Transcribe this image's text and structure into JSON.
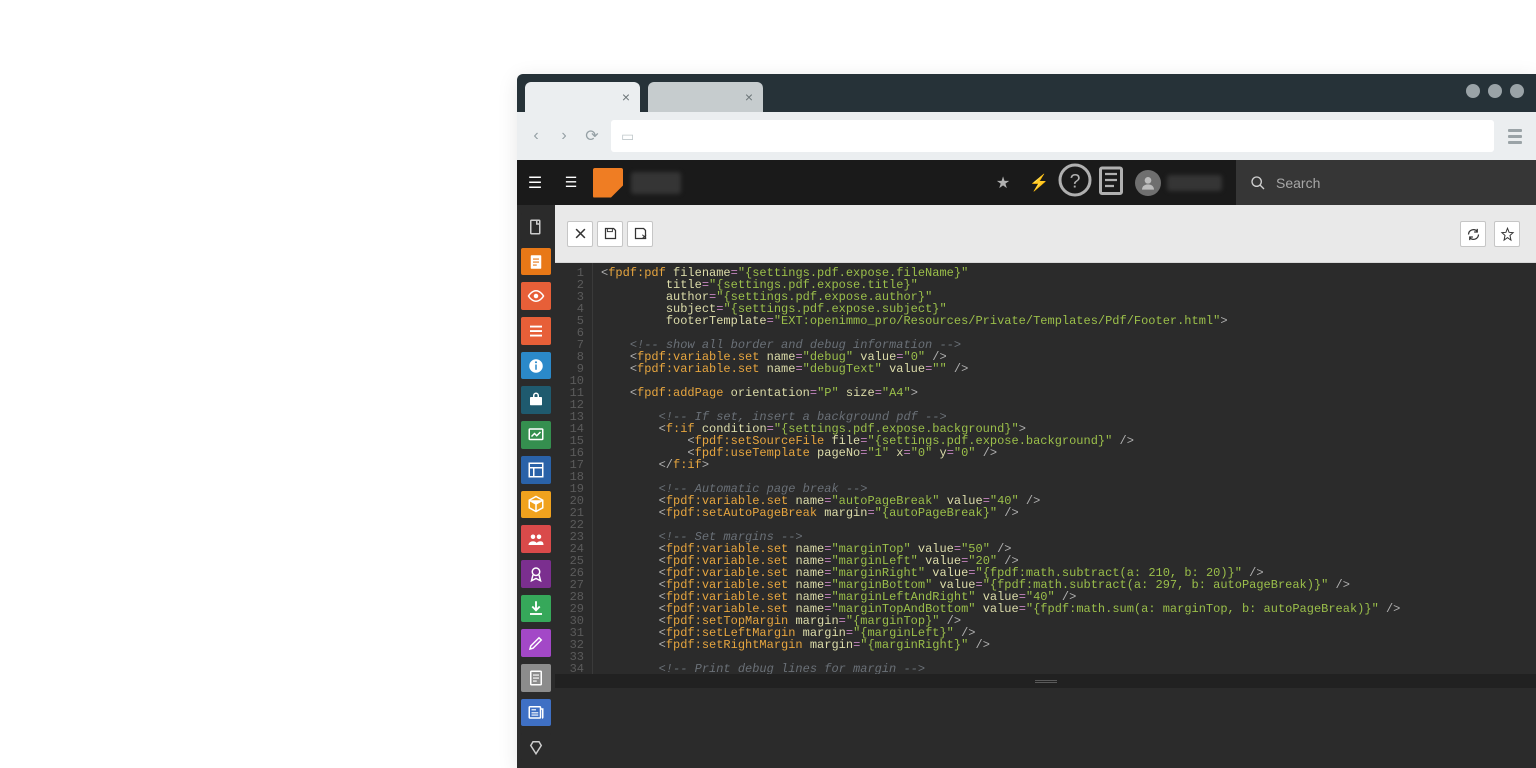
{
  "browser": {
    "tabs": [
      {
        "close_label": "×"
      },
      {
        "close_label": "×"
      }
    ]
  },
  "topbar": {
    "search_placeholder": "Search"
  },
  "sidebar": {
    "items": [
      {
        "name": "file",
        "color": "#2b2b2b"
      },
      {
        "name": "page",
        "color": "#e87817"
      },
      {
        "name": "view",
        "color": "#e75f38"
      },
      {
        "name": "list",
        "color": "#e75f38"
      },
      {
        "name": "info",
        "color": "#2b89c9"
      },
      {
        "name": "tools",
        "color": "#1f5a6e"
      },
      {
        "name": "chart",
        "color": "#358f4f"
      },
      {
        "name": "layout",
        "color": "#2a62a8"
      },
      {
        "name": "package",
        "color": "#f0a21e"
      },
      {
        "name": "users",
        "color": "#d94a4a"
      },
      {
        "name": "badge",
        "color": "#7b2f8f"
      },
      {
        "name": "download",
        "color": "#36a85a"
      },
      {
        "name": "edit",
        "color": "#a348c7"
      },
      {
        "name": "doc",
        "color": "#8c8c8c"
      },
      {
        "name": "news",
        "color": "#3f70c4"
      },
      {
        "name": "clear",
        "color": "#2b2b2b"
      }
    ]
  },
  "code": {
    "lines": [
      {
        "n": "1",
        "seg": [
          {
            "t": "<",
            "c": "punct"
          },
          {
            "t": "fpdf:pdf",
            "c": "tag"
          },
          {
            "t": " "
          },
          {
            "t": "filename",
            "c": "attr"
          },
          {
            "t": "=",
            "c": "op"
          },
          {
            "t": "\"{settings.pdf.expose.fileName}\"",
            "c": "str"
          }
        ]
      },
      {
        "n": "2",
        "seg": [
          {
            "t": "         "
          },
          {
            "t": "title",
            "c": "attr"
          },
          {
            "t": "=",
            "c": "op"
          },
          {
            "t": "\"{settings.pdf.expose.title}\"",
            "c": "str"
          }
        ]
      },
      {
        "n": "3",
        "seg": [
          {
            "t": "         "
          },
          {
            "t": "author",
            "c": "attr"
          },
          {
            "t": "=",
            "c": "op"
          },
          {
            "t": "\"{settings.pdf.expose.author}\"",
            "c": "str"
          }
        ]
      },
      {
        "n": "4",
        "seg": [
          {
            "t": "         "
          },
          {
            "t": "subject",
            "c": "attr"
          },
          {
            "t": "=",
            "c": "op"
          },
          {
            "t": "\"{settings.pdf.expose.subject}\"",
            "c": "str"
          }
        ]
      },
      {
        "n": "5",
        "seg": [
          {
            "t": "         "
          },
          {
            "t": "footerTemplate",
            "c": "attr"
          },
          {
            "t": "=",
            "c": "op"
          },
          {
            "t": "\"EXT:openimmo_pro/Resources/Private/Templates/Pdf/Footer.html\"",
            "c": "str"
          },
          {
            "t": ">",
            "c": "punct"
          }
        ]
      },
      {
        "n": "6",
        "seg": [
          {
            "t": " "
          }
        ]
      },
      {
        "n": "7",
        "seg": [
          {
            "t": "    "
          },
          {
            "t": "<!-- show all border and debug information -->",
            "c": "comment"
          }
        ]
      },
      {
        "n": "8",
        "seg": [
          {
            "t": "    "
          },
          {
            "t": "<",
            "c": "punct"
          },
          {
            "t": "fpdf:variable.set",
            "c": "tag"
          },
          {
            "t": " "
          },
          {
            "t": "name",
            "c": "attr"
          },
          {
            "t": "=",
            "c": "op"
          },
          {
            "t": "\"debug\"",
            "c": "str"
          },
          {
            "t": " "
          },
          {
            "t": "value",
            "c": "attr"
          },
          {
            "t": "=",
            "c": "op"
          },
          {
            "t": "\"0\"",
            "c": "str"
          },
          {
            "t": " />",
            "c": "punct"
          }
        ]
      },
      {
        "n": "9",
        "seg": [
          {
            "t": "    "
          },
          {
            "t": "<",
            "c": "punct"
          },
          {
            "t": "fpdf:variable.set",
            "c": "tag"
          },
          {
            "t": " "
          },
          {
            "t": "name",
            "c": "attr"
          },
          {
            "t": "=",
            "c": "op"
          },
          {
            "t": "\"debugText\"",
            "c": "str"
          },
          {
            "t": " "
          },
          {
            "t": "value",
            "c": "attr"
          },
          {
            "t": "=",
            "c": "op"
          },
          {
            "t": "\"\"",
            "c": "str"
          },
          {
            "t": " />",
            "c": "punct"
          }
        ]
      },
      {
        "n": "10",
        "seg": [
          {
            "t": " "
          }
        ]
      },
      {
        "n": "11",
        "seg": [
          {
            "t": "    "
          },
          {
            "t": "<",
            "c": "punct"
          },
          {
            "t": "fpdf:addPage",
            "c": "tag"
          },
          {
            "t": " "
          },
          {
            "t": "orientation",
            "c": "attr"
          },
          {
            "t": "=",
            "c": "op"
          },
          {
            "t": "\"P\"",
            "c": "str"
          },
          {
            "t": " "
          },
          {
            "t": "size",
            "c": "attr"
          },
          {
            "t": "=",
            "c": "op"
          },
          {
            "t": "\"A4\"",
            "c": "str"
          },
          {
            "t": ">",
            "c": "punct"
          }
        ]
      },
      {
        "n": "12",
        "seg": [
          {
            "t": " "
          }
        ]
      },
      {
        "n": "13",
        "seg": [
          {
            "t": "        "
          },
          {
            "t": "<!-- If set, insert a background pdf -->",
            "c": "comment"
          }
        ]
      },
      {
        "n": "14",
        "seg": [
          {
            "t": "        "
          },
          {
            "t": "<",
            "c": "punct"
          },
          {
            "t": "f:if",
            "c": "tag"
          },
          {
            "t": " "
          },
          {
            "t": "condition",
            "c": "attr"
          },
          {
            "t": "=",
            "c": "op"
          },
          {
            "t": "\"{settings.pdf.expose.background}\"",
            "c": "str"
          },
          {
            "t": ">",
            "c": "punct"
          }
        ]
      },
      {
        "n": "15",
        "seg": [
          {
            "t": "            "
          },
          {
            "t": "<",
            "c": "punct"
          },
          {
            "t": "fpdf:setSourceFile",
            "c": "tag"
          },
          {
            "t": " "
          },
          {
            "t": "file",
            "c": "attr"
          },
          {
            "t": "=",
            "c": "op"
          },
          {
            "t": "\"{settings.pdf.expose.background}\"",
            "c": "str"
          },
          {
            "t": " />",
            "c": "punct"
          }
        ]
      },
      {
        "n": "16",
        "seg": [
          {
            "t": "            "
          },
          {
            "t": "<",
            "c": "punct"
          },
          {
            "t": "fpdf:useTemplate",
            "c": "tag"
          },
          {
            "t": " "
          },
          {
            "t": "pageNo",
            "c": "attr"
          },
          {
            "t": "=",
            "c": "op"
          },
          {
            "t": "\"1\"",
            "c": "str"
          },
          {
            "t": " "
          },
          {
            "t": "x",
            "c": "attr"
          },
          {
            "t": "=",
            "c": "op"
          },
          {
            "t": "\"0\"",
            "c": "str"
          },
          {
            "t": " "
          },
          {
            "t": "y",
            "c": "attr"
          },
          {
            "t": "=",
            "c": "op"
          },
          {
            "t": "\"0\"",
            "c": "str"
          },
          {
            "t": " />",
            "c": "punct"
          }
        ]
      },
      {
        "n": "17",
        "seg": [
          {
            "t": "        "
          },
          {
            "t": "</",
            "c": "punct"
          },
          {
            "t": "f:if",
            "c": "tag"
          },
          {
            "t": ">",
            "c": "punct"
          }
        ]
      },
      {
        "n": "18",
        "seg": [
          {
            "t": " "
          }
        ]
      },
      {
        "n": "19",
        "seg": [
          {
            "t": "        "
          },
          {
            "t": "<!-- Automatic page break -->",
            "c": "comment"
          }
        ]
      },
      {
        "n": "20",
        "seg": [
          {
            "t": "        "
          },
          {
            "t": "<",
            "c": "punct"
          },
          {
            "t": "fpdf:variable.set",
            "c": "tag"
          },
          {
            "t": " "
          },
          {
            "t": "name",
            "c": "attr"
          },
          {
            "t": "=",
            "c": "op"
          },
          {
            "t": "\"autoPageBreak\"",
            "c": "str"
          },
          {
            "t": " "
          },
          {
            "t": "value",
            "c": "attr"
          },
          {
            "t": "=",
            "c": "op"
          },
          {
            "t": "\"40\"",
            "c": "str"
          },
          {
            "t": " />",
            "c": "punct"
          }
        ]
      },
      {
        "n": "21",
        "seg": [
          {
            "t": "        "
          },
          {
            "t": "<",
            "c": "punct"
          },
          {
            "t": "fpdf:setAutoPageBreak",
            "c": "tag"
          },
          {
            "t": " "
          },
          {
            "t": "margin",
            "c": "attr"
          },
          {
            "t": "=",
            "c": "op"
          },
          {
            "t": "\"{autoPageBreak}\"",
            "c": "str"
          },
          {
            "t": " />",
            "c": "punct"
          }
        ]
      },
      {
        "n": "22",
        "seg": [
          {
            "t": " "
          }
        ]
      },
      {
        "n": "23",
        "seg": [
          {
            "t": "        "
          },
          {
            "t": "<!-- Set margins -->",
            "c": "comment"
          }
        ]
      },
      {
        "n": "24",
        "seg": [
          {
            "t": "        "
          },
          {
            "t": "<",
            "c": "punct"
          },
          {
            "t": "fpdf:variable.set",
            "c": "tag"
          },
          {
            "t": " "
          },
          {
            "t": "name",
            "c": "attr"
          },
          {
            "t": "=",
            "c": "op"
          },
          {
            "t": "\"marginTop\"",
            "c": "str"
          },
          {
            "t": " "
          },
          {
            "t": "value",
            "c": "attr"
          },
          {
            "t": "=",
            "c": "op"
          },
          {
            "t": "\"50\"",
            "c": "str"
          },
          {
            "t": " />",
            "c": "punct"
          }
        ]
      },
      {
        "n": "25",
        "seg": [
          {
            "t": "        "
          },
          {
            "t": "<",
            "c": "punct"
          },
          {
            "t": "fpdf:variable.set",
            "c": "tag"
          },
          {
            "t": " "
          },
          {
            "t": "name",
            "c": "attr"
          },
          {
            "t": "=",
            "c": "op"
          },
          {
            "t": "\"marginLeft\"",
            "c": "str"
          },
          {
            "t": " "
          },
          {
            "t": "value",
            "c": "attr"
          },
          {
            "t": "=",
            "c": "op"
          },
          {
            "t": "\"20\"",
            "c": "str"
          },
          {
            "t": " />",
            "c": "punct"
          }
        ]
      },
      {
        "n": "26",
        "seg": [
          {
            "t": "        "
          },
          {
            "t": "<",
            "c": "punct"
          },
          {
            "t": "fpdf:variable.set",
            "c": "tag"
          },
          {
            "t": " "
          },
          {
            "t": "name",
            "c": "attr"
          },
          {
            "t": "=",
            "c": "op"
          },
          {
            "t": "\"marginRight\"",
            "c": "str"
          },
          {
            "t": " "
          },
          {
            "t": "value",
            "c": "attr"
          },
          {
            "t": "=",
            "c": "op"
          },
          {
            "t": "\"{fpdf:math.subtract(a: 210, b: 20)}\"",
            "c": "str"
          },
          {
            "t": " />",
            "c": "punct"
          }
        ]
      },
      {
        "n": "27",
        "seg": [
          {
            "t": "        "
          },
          {
            "t": "<",
            "c": "punct"
          },
          {
            "t": "fpdf:variable.set",
            "c": "tag"
          },
          {
            "t": " "
          },
          {
            "t": "name",
            "c": "attr"
          },
          {
            "t": "=",
            "c": "op"
          },
          {
            "t": "\"marginBottom\"",
            "c": "str"
          },
          {
            "t": " "
          },
          {
            "t": "value",
            "c": "attr"
          },
          {
            "t": "=",
            "c": "op"
          },
          {
            "t": "\"{fpdf:math.subtract(a: 297, b: autoPageBreak)}\"",
            "c": "str"
          },
          {
            "t": " />",
            "c": "punct"
          }
        ]
      },
      {
        "n": "28",
        "seg": [
          {
            "t": "        "
          },
          {
            "t": "<",
            "c": "punct"
          },
          {
            "t": "fpdf:variable.set",
            "c": "tag"
          },
          {
            "t": " "
          },
          {
            "t": "name",
            "c": "attr"
          },
          {
            "t": "=",
            "c": "op"
          },
          {
            "t": "\"marginLeftAndRight\"",
            "c": "str"
          },
          {
            "t": " "
          },
          {
            "t": "value",
            "c": "attr"
          },
          {
            "t": "=",
            "c": "op"
          },
          {
            "t": "\"40\"",
            "c": "str"
          },
          {
            "t": " />",
            "c": "punct"
          }
        ]
      },
      {
        "n": "29",
        "seg": [
          {
            "t": "        "
          },
          {
            "t": "<",
            "c": "punct"
          },
          {
            "t": "fpdf:variable.set",
            "c": "tag"
          },
          {
            "t": " "
          },
          {
            "t": "name",
            "c": "attr"
          },
          {
            "t": "=",
            "c": "op"
          },
          {
            "t": "\"marginTopAndBottom\"",
            "c": "str"
          },
          {
            "t": " "
          },
          {
            "t": "value",
            "c": "attr"
          },
          {
            "t": "=",
            "c": "op"
          },
          {
            "t": "\"{fpdf:math.sum(a: marginTop, b: autoPageBreak)}\"",
            "c": "str"
          },
          {
            "t": " />",
            "c": "punct"
          }
        ]
      },
      {
        "n": "30",
        "seg": [
          {
            "t": "        "
          },
          {
            "t": "<",
            "c": "punct"
          },
          {
            "t": "fpdf:setTopMargin",
            "c": "tag"
          },
          {
            "t": " "
          },
          {
            "t": "margin",
            "c": "attr"
          },
          {
            "t": "=",
            "c": "op"
          },
          {
            "t": "\"{marginTop}\"",
            "c": "str"
          },
          {
            "t": " />",
            "c": "punct"
          }
        ]
      },
      {
        "n": "31",
        "seg": [
          {
            "t": "        "
          },
          {
            "t": "<",
            "c": "punct"
          },
          {
            "t": "fpdf:setLeftMargin",
            "c": "tag"
          },
          {
            "t": " "
          },
          {
            "t": "margin",
            "c": "attr"
          },
          {
            "t": "=",
            "c": "op"
          },
          {
            "t": "\"{marginLeft}\"",
            "c": "str"
          },
          {
            "t": " />",
            "c": "punct"
          }
        ]
      },
      {
        "n": "32",
        "seg": [
          {
            "t": "        "
          },
          {
            "t": "<",
            "c": "punct"
          },
          {
            "t": "fpdf:setRightMargin",
            "c": "tag"
          },
          {
            "t": " "
          },
          {
            "t": "margin",
            "c": "attr"
          },
          {
            "t": "=",
            "c": "op"
          },
          {
            "t": "\"{marginRight}\"",
            "c": "str"
          },
          {
            "t": " />",
            "c": "punct"
          }
        ]
      },
      {
        "n": "33",
        "seg": [
          {
            "t": " "
          }
        ]
      },
      {
        "n": "34",
        "seg": [
          {
            "t": "        "
          },
          {
            "t": "<!-- Print debug lines for margin -->",
            "c": "comment"
          }
        ]
      }
    ]
  }
}
